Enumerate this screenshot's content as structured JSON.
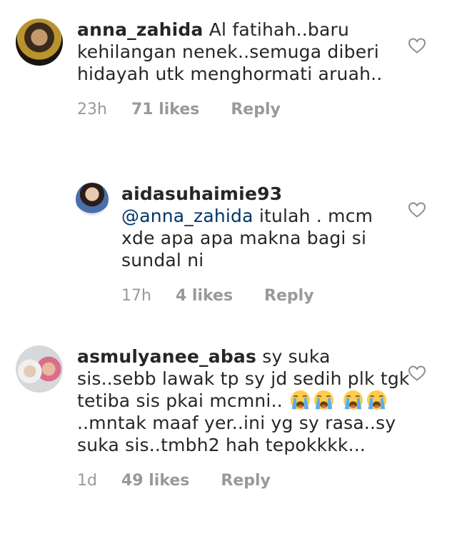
{
  "comments": [
    {
      "username": "anna_zahida",
      "text": "Al fatihah..baru kehilangan nenek..semuga diberi hidayah utk menghormati aruah..",
      "time": "23h",
      "likes": "71 likes",
      "reply": "Reply"
    },
    {
      "username": "aidasuhaimie93",
      "mention": "@anna_zahida",
      "text": "itulah . mcm xde apa apa makna bagi si sundal ni",
      "time": "17h",
      "likes": "4 likes",
      "reply": "Reply"
    },
    {
      "username": "asmulyanee_abas",
      "text_a": "sy suka sis..sebb lawak tp sy jd sedih plk tgk tetiba sis pkai mcmni..",
      "text_b": "..mntak maaf yer..ini yg sy rasa..sy suka sis..tmbh2 hah tepokkkk...",
      "emoji": "loudly-crying-face",
      "time": "1d",
      "likes": "49 likes",
      "reply": "Reply"
    }
  ],
  "icons": {
    "like": "heart-outline-icon"
  },
  "colors": {
    "text": "#262626",
    "meta": "#999999",
    "mention": "#003569",
    "heart": "#8e8e8e"
  }
}
